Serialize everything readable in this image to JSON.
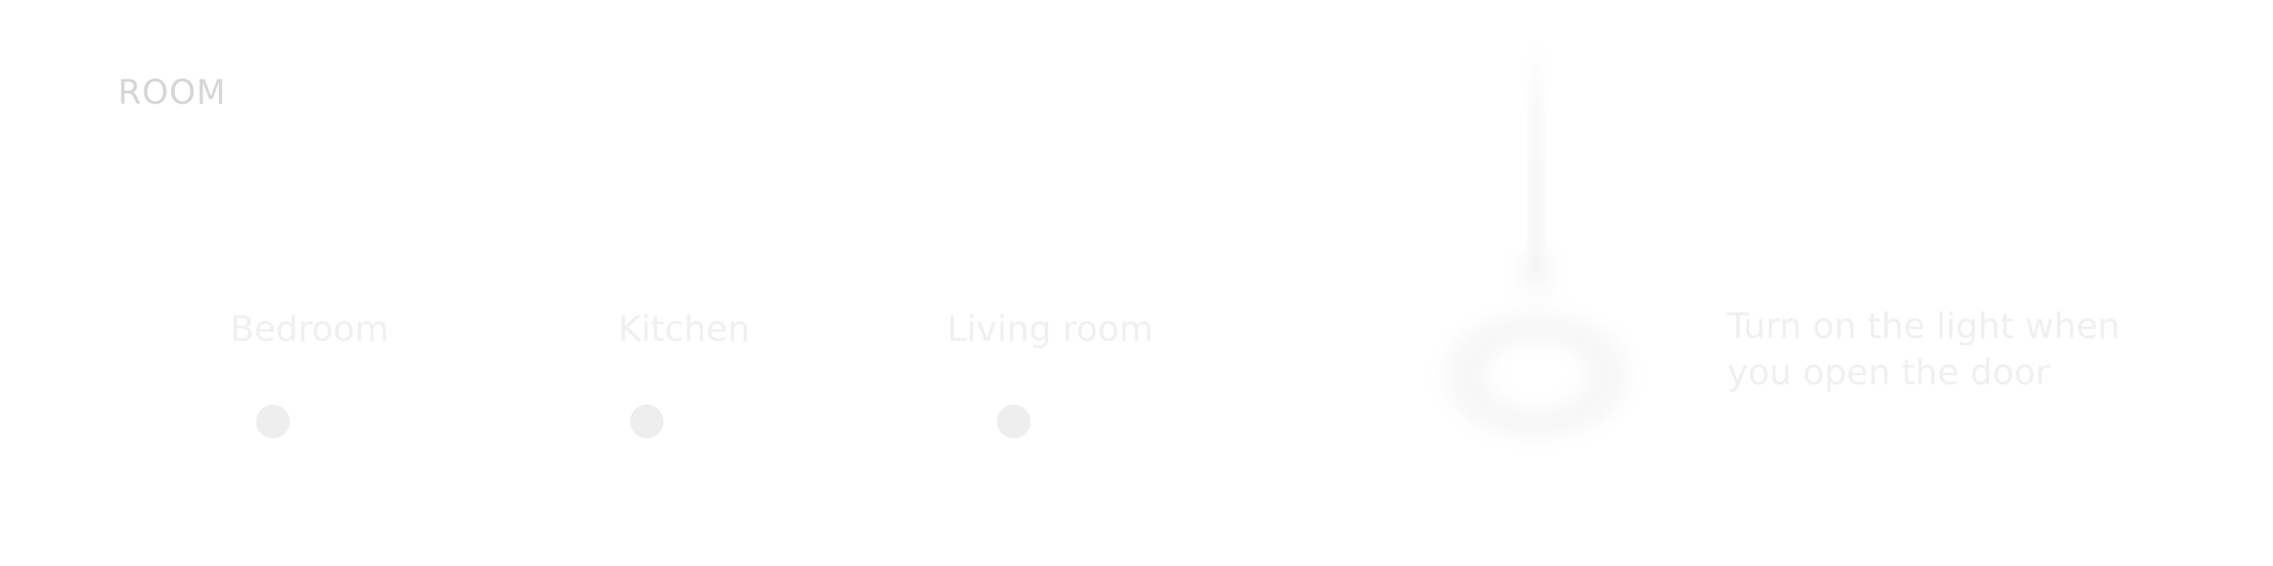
{
  "section": {
    "title": "ROOM"
  },
  "rooms": [
    {
      "label": "Bedroom"
    },
    {
      "label": "Kitchen"
    },
    {
      "label": "Living room"
    }
  ],
  "hint": {
    "line1": "Turn on the light when",
    "line2": "you open the door"
  },
  "icons": {
    "lamp": "pendant-lamp-icon"
  },
  "colors": {
    "background": "#ffffff",
    "title": "#d6d6d6",
    "faded_text": "#f0f0f0",
    "dot": "#eeeeee"
  }
}
